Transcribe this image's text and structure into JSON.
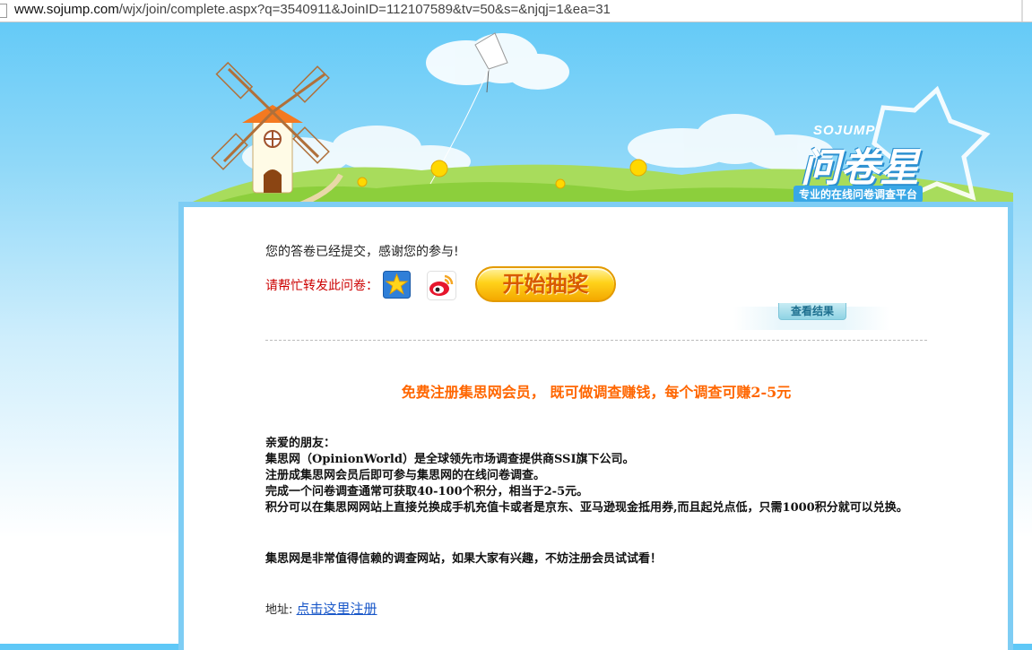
{
  "browser": {
    "url_host": "www.sojump.com",
    "url_path": "/wjx/join/complete.aspx?q=3540911&JoinID=112107589&tv=50&s=&njqj=1&ea=31"
  },
  "header": {
    "logo_en": "SOJUMP",
    "logo_cn": "问卷星",
    "logo_tagline": "专业的在线问卷调查平台"
  },
  "content": {
    "thanks_message": "您的答卷已经提交，感谢您的参与!",
    "share_label": "请帮忙转发此问卷：",
    "qzone_icon": "qzone-icon",
    "weibo_icon": "weibo-icon",
    "lottery_button": "开始抽奖",
    "view_results_tab": "查看结果",
    "promo_headline": "免费注册集思网会员， 既可做调查赚钱，每个调查可赚2-5元",
    "promo_lines": [
      "亲爱的朋友：",
      "集思网（OpinionWorld）是全球领先市场调查提供商SSI旗下公司。",
      "注册成集思网会员后即可参与集思网的在线问卷调查。",
      "完成一个问卷调查通常可获取40-100个积分，相当于2-5元。",
      "积分可以在集思网网站上直接兑换成手机充值卡或者是京东、亚马逊现金抵用券,而且起兑点低，只需1000积分就可以兑换。"
    ],
    "promo_trust": "集思网是非常值得信赖的调查网站，如果大家有兴趣，不妨注册会员试试看！",
    "address_label": "地址:",
    "register_link": "点击这里注册"
  },
  "colors": {
    "sky": "#5ec8f7",
    "panel_border": "#7ecdf4",
    "promo_orange": "#ff6600",
    "link_blue": "#1a58c9",
    "share_red": "#cc0000"
  }
}
